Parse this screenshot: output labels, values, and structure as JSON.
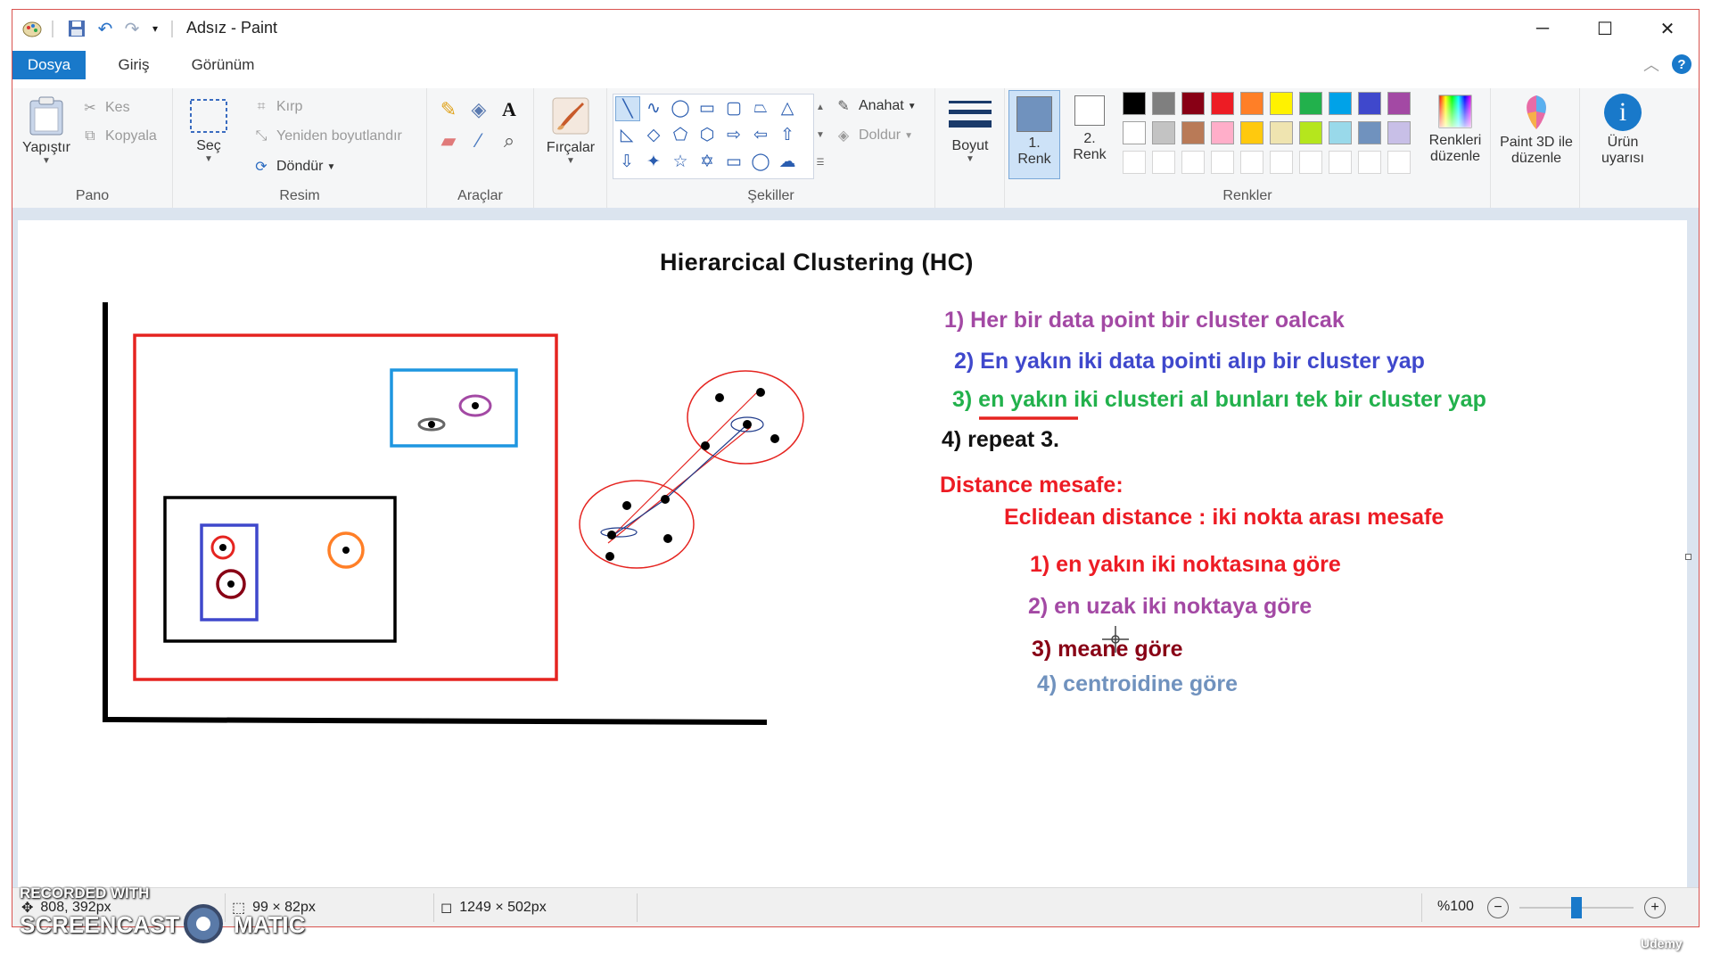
{
  "window": {
    "title": "Adsız - Paint",
    "controls": {
      "minimize": "─",
      "maximize": "☐",
      "close": "✕"
    }
  },
  "tabs": [
    "Dosya",
    "Giriş",
    "Görünüm"
  ],
  "ribbon": {
    "pano": {
      "label": "Pano",
      "paste": "Yapıştır",
      "cut": "Kes",
      "copy": "Kopyala"
    },
    "resim": {
      "label": "Resim",
      "select": "Seç",
      "crop": "Kırp",
      "resize": "Yeniden boyutlandır",
      "rotate": "Döndür"
    },
    "araclar": {
      "label": "Araçlar"
    },
    "brushes": {
      "label": "Fırçalar"
    },
    "sekiller": {
      "label": "Şekiller",
      "outline": "Anahat",
      "fill": "Doldur"
    },
    "boyut": {
      "label": "Boyut"
    },
    "renkler": {
      "label": "Renkler",
      "color1_num": "1.",
      "color1": "Renk",
      "color2_num": "2.",
      "color2": "Renk",
      "edit_colors_1": "Renkleri",
      "edit_colors_2": "düzenle",
      "row1": [
        "#000000",
        "#7f7f7f",
        "#880015",
        "#ed1c24",
        "#ff7f27",
        "#fff200",
        "#22b14c",
        "#00a2e8",
        "#3f48cc",
        "#a349a4"
      ],
      "row2": [
        "#ffffff",
        "#c3c3c3",
        "#b97a57",
        "#ffaec9",
        "#ffc90e",
        "#efe4b0",
        "#b5e61d",
        "#99d9ea",
        "#7092be",
        "#c8bfe7"
      ],
      "color1_value": "#7092be",
      "color2_value": "#ffffff"
    },
    "paint3d": {
      "line1": "Paint 3D ile",
      "line2": "düzenle"
    },
    "alert": {
      "line1": "Ürün",
      "line2": "uyarısı"
    }
  },
  "canvas": {
    "heading": "Hierarcical Clustering  (HC)",
    "steps": [
      {
        "text": "1) Her bir data point bir cluster oalcak",
        "color": "#a349a4"
      },
      {
        "text": "2) En yakın iki data pointi alıp bir cluster yap",
        "color": "#3f48cc"
      },
      {
        "text": "3) en yakın iki clusteri al bunları tek bir cluster yap",
        "color": "#22b14c"
      },
      {
        "text": "4) repeat 3.",
        "color": "#111111"
      }
    ],
    "distance_title": "Distance mesafe:",
    "euclid": "Eclidean distance : iki nokta arası mesafe",
    "methods": [
      {
        "text": "1) en yakın iki noktasına göre",
        "color": "#ed1c24"
      },
      {
        "text": "2) en uzak iki noktaya göre",
        "color": "#a349a4"
      },
      {
        "text": "3) meane göre",
        "color": "#880015"
      },
      {
        "text": "4) centroidine göre",
        "color": "#7092be"
      }
    ]
  },
  "status": {
    "cursor_pos": "808, 392px",
    "selection_size": "99 × 82px",
    "canvas_size": "1249 × 502px",
    "zoom": "%100",
    "zoom_level": 100
  },
  "watermark": {
    "line1": "RECORDED WITH",
    "brand_left": "SCREENCAST",
    "brand_right": "MATIC",
    "corner": "Udemy"
  }
}
